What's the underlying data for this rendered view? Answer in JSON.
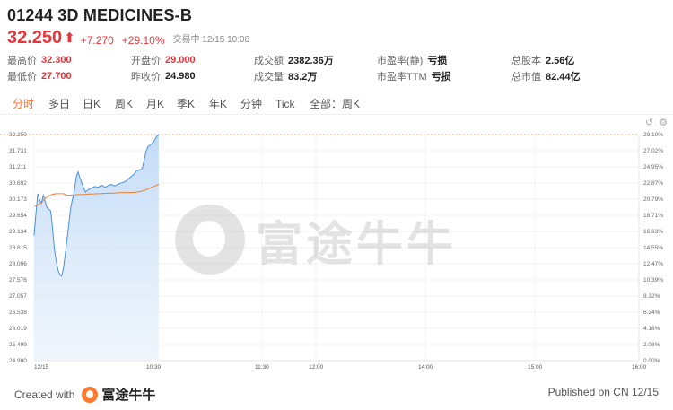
{
  "stock": {
    "code_name": "01244 3D MEDICINES-B",
    "price": "32.250",
    "change": "+7.270",
    "change_pct": "+29.10%",
    "status": "交易中 12/15 10:08"
  },
  "stats": [
    {
      "label": "最高价",
      "value": "32.300",
      "tone": "red"
    },
    {
      "label": "开盘价",
      "value": "29.000",
      "tone": "red"
    },
    {
      "label": "成交额",
      "value": "2382.36万",
      "tone": "plain"
    },
    {
      "label": "市盈率(静)",
      "value": "亏损",
      "tone": "plain"
    },
    {
      "label": "总股本",
      "value": "2.56亿",
      "tone": "plain"
    },
    {
      "label": "最低价",
      "value": "27.700",
      "tone": "red"
    },
    {
      "label": "昨收价",
      "value": "24.980",
      "tone": "plain"
    },
    {
      "label": "成交量",
      "value": "83.2万",
      "tone": "plain"
    },
    {
      "label": "市盈率TTM",
      "value": "亏损",
      "tone": "plain"
    },
    {
      "label": "总市值",
      "value": "82.44亿",
      "tone": "plain"
    }
  ],
  "tabs": [
    "分时",
    "多日",
    "日K",
    "周K",
    "月K",
    "季K",
    "年K",
    "分钟",
    "Tick",
    "全部：周K"
  ],
  "active_tab": "分时",
  "icons": [
    "undo-icon",
    "settings-icon"
  ],
  "watermark": "富途牛牛",
  "footer": {
    "created_label": "Created with",
    "brand": "富途牛牛",
    "published": "Published on CN 12/15"
  },
  "colors": {
    "up": "#e8353b",
    "accent": "#ff6b2c",
    "price_line": "#4a90e2",
    "avg_line": "#f08030"
  },
  "chart_data": {
    "type": "line",
    "y_left_ticks": [
      "32.250",
      "31.731",
      "31.211",
      "30.692",
      "30.173",
      "29.654",
      "29.134",
      "28.615",
      "28.096",
      "27.576",
      "27.057",
      "26.538",
      "26.019",
      "25.499",
      "24.980"
    ],
    "y_right_ticks": [
      "29.10%",
      "27.02%",
      "24.95%",
      "22.87%",
      "20.79%",
      "18.71%",
      "16.63%",
      "14.55%",
      "12.47%",
      "10.39%",
      "8.32%",
      "6.24%",
      "4.16%",
      "2.08%",
      "0.00%"
    ],
    "x_ticks": [
      "12/15",
      "10:30",
      "11:30",
      "12:00",
      "14:00",
      "15:00",
      "16:00"
    ],
    "ylim": [
      24.98,
      32.25
    ],
    "reference_line": 32.25,
    "series": [
      {
        "kind": "price",
        "x": [
          0,
          1,
          2,
          3,
          4,
          5,
          6,
          7,
          8,
          9,
          10,
          11,
          12,
          13,
          14,
          15,
          16,
          17,
          18,
          19,
          20,
          21,
          22,
          23,
          24,
          25,
          26,
          27,
          28,
          29,
          30,
          31,
          32,
          33,
          34,
          35,
          36,
          37,
          38,
          39,
          40,
          41,
          42,
          43,
          44,
          45,
          46,
          47,
          48,
          49,
          50,
          51,
          52,
          53,
          54,
          55,
          56,
          57,
          58,
          59,
          60,
          61,
          62,
          63,
          64,
          65,
          66,
          67,
          68
        ],
        "values": [
          29.0,
          29.7,
          30.35,
          30.15,
          30.05,
          30.3,
          30.1,
          29.9,
          29.85,
          29.8,
          29.3,
          28.6,
          28.2,
          27.9,
          27.75,
          27.7,
          27.95,
          28.4,
          28.9,
          29.4,
          29.9,
          30.2,
          30.45,
          30.9,
          31.05,
          30.85,
          30.7,
          30.55,
          30.4,
          30.45,
          30.5,
          30.52,
          30.55,
          30.58,
          30.57,
          30.55,
          30.6,
          30.62,
          30.58,
          30.56,
          30.6,
          30.63,
          30.65,
          30.62,
          30.6,
          30.63,
          30.66,
          30.68,
          30.7,
          30.72,
          30.75,
          30.8,
          30.85,
          30.9,
          30.95,
          31.0,
          31.1,
          31.1,
          31.12,
          31.15,
          31.4,
          31.7,
          31.85,
          31.9,
          31.95,
          32.0,
          32.1,
          32.2,
          32.25
        ]
      },
      {
        "kind": "average",
        "x": [
          0,
          2,
          4,
          6,
          8,
          10,
          12,
          14,
          16,
          18,
          20,
          22,
          24,
          26,
          28,
          30,
          32,
          34,
          36,
          38,
          40,
          42,
          44,
          46,
          48,
          50,
          52,
          54,
          56,
          58,
          60,
          62,
          64,
          66,
          68
        ],
        "values": [
          29.95,
          29.98,
          30.05,
          30.2,
          30.28,
          30.33,
          30.35,
          30.35,
          30.35,
          30.3,
          30.3,
          30.31,
          30.32,
          30.32,
          30.33,
          30.34,
          30.34,
          30.35,
          30.35,
          30.36,
          30.36,
          30.37,
          30.37,
          30.38,
          30.38,
          30.38,
          30.39,
          30.39,
          30.4,
          30.42,
          30.45,
          30.5,
          30.55,
          30.6,
          30.65
        ]
      }
    ]
  }
}
